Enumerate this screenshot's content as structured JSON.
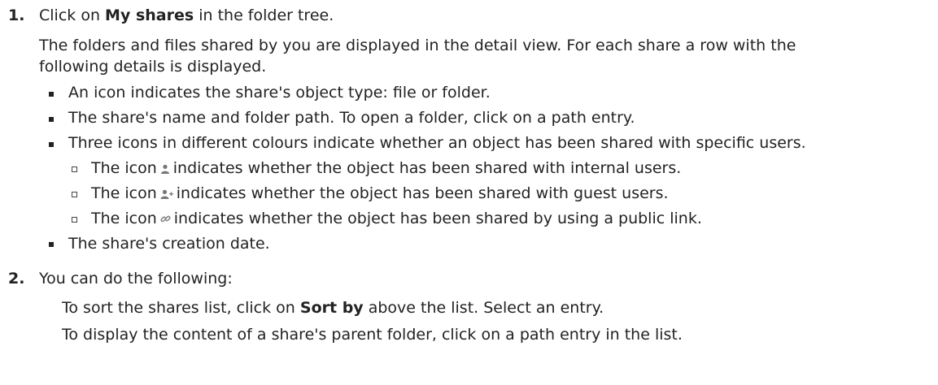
{
  "step1": {
    "number": "1.",
    "intro_before": "Click on ",
    "intro_bold": "My shares",
    "intro_after": " in the folder tree.",
    "desc_line1": "The folders and files shared by you are displayed in the detail view. For each share a row with the",
    "desc_line2": "following details is displayed.",
    "bullets": [
      "An icon indicates the share's object type: file or folder.",
      "The share's name and folder path. To open a folder, click on a path entry.",
      "Three icons in different colours indicate whether an object has been shared with specific users."
    ],
    "subbullets": [
      {
        "before": "The icon",
        "after": "indicates whether the object has been shared with internal users.",
        "icon": "user-icon"
      },
      {
        "before": "The icon",
        "after": "indicates whether the object has been shared with guest users.",
        "icon": "add-user-icon"
      },
      {
        "before": "The icon",
        "after": "indicates whether the object has been shared by using a public link.",
        "icon": "link-icon"
      }
    ],
    "last_bullet": "The share's creation date."
  },
  "step2": {
    "number": "2.",
    "intro": "You can do the following:",
    "line1_before": "To sort the shares list, click on ",
    "line1_bold": "Sort by",
    "line1_after": " above the list. Select an entry.",
    "line2": "To display the content of a share's parent folder, click on a path entry in the list."
  }
}
